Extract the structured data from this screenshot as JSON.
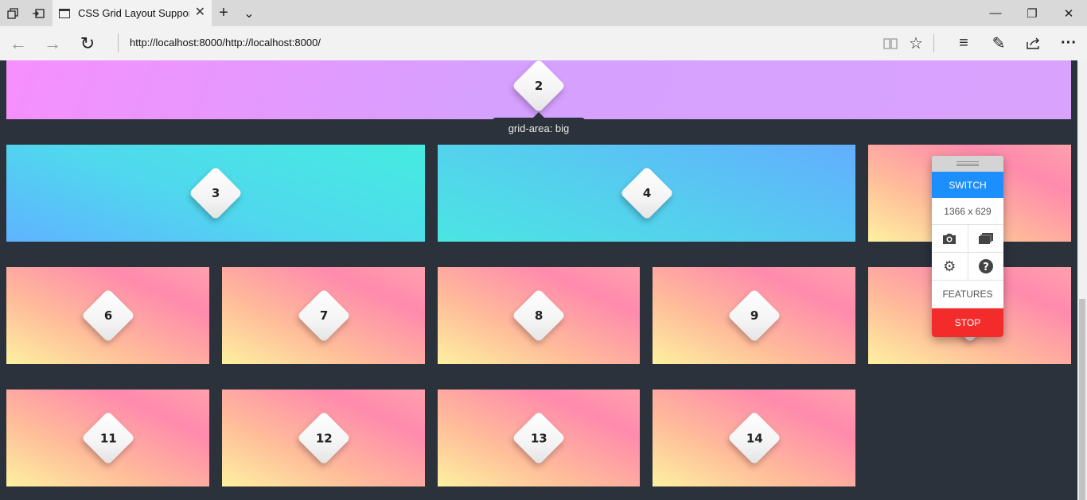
{
  "browser": {
    "tab_title": "CSS Grid Layout Suppor",
    "url": "http://localhost:8000/http://localhost:8000/",
    "icons": {
      "tab_actions": "tab-list-icon",
      "set_aside": "set-aside-tabs-icon",
      "new_tab": "+",
      "tab_menu": "⌄",
      "back": "←",
      "forward": "→",
      "refresh": "↻",
      "reading": "reading-view-icon",
      "favorite": "☆",
      "hub": "≡",
      "notes": "✎",
      "share": "share-icon",
      "more": "···",
      "minimize": "—",
      "restore": "❐",
      "close": "✕"
    }
  },
  "grid": {
    "tooltip": "grid-area: big",
    "items": [
      "2",
      "3",
      "4",
      "6",
      "7",
      "8",
      "9",
      "11",
      "12",
      "13",
      "14"
    ]
  },
  "widget": {
    "switch": "SWITCH",
    "size": "1366 x 629",
    "features": "FEATURES",
    "stop": "STOP",
    "icons": [
      "camera-icon",
      "gallery-icon",
      "gear-icon",
      "help-icon"
    ]
  },
  "colors": {
    "background": "#2b323c",
    "switch": "#1c8ffd",
    "stop": "#f42b2b"
  }
}
